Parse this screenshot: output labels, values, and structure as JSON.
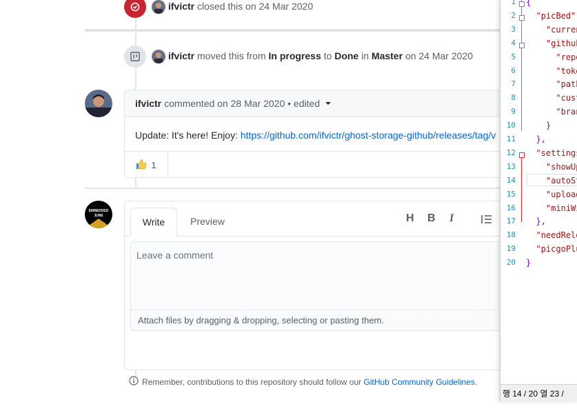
{
  "timeline": {
    "closed_event": {
      "user": "ifvictr",
      "action": "closed this on 24 Mar 2020"
    },
    "moved_event": {
      "user": "ifvictr",
      "text_moved": "moved this from",
      "from": "In progress",
      "to_word": "to",
      "to": "Done",
      "in_word": "in",
      "project": "Master",
      "date": "on 24 Mar 2020"
    }
  },
  "comment": {
    "author": "ifvictr",
    "meta": "commented on 28 Mar 2020 • edited",
    "body_text": "Update: It's here! Enjoy: ",
    "body_link": "https://github.com/ifvictr/ghost-storage-github/releases/tag/v",
    "reaction_count": "1"
  },
  "composer": {
    "tab_write": "Write",
    "tab_preview": "Preview",
    "tools": [
      "H",
      "B",
      "I"
    ],
    "placeholder": "Leave a comment",
    "attach_text": "Attach files by dragging & dropping, selecting or pasting them.",
    "avatar_text_1": "EMBEDDED",
    "avatar_text_2": "JUNE"
  },
  "guidelines": {
    "prefix": "Remember, contributions to this repository should follow our ",
    "link": "GitHub Community Guidelines",
    "suffix": "."
  },
  "editor": {
    "line_numbers": [
      "1",
      "2",
      "3",
      "4",
      "5",
      "6",
      "7",
      "8",
      "9",
      "10",
      "11",
      "12",
      "13",
      "14",
      "15",
      "16",
      "17",
      "18",
      "19",
      "20"
    ],
    "lines": [
      "{",
      "  \"picBed\":",
      "    \"curren",
      "    \"github",
      "      \"repo",
      "      \"toke",
      "      \"path",
      "      \"cust",
      "      \"bran",
      "    }",
      "  },",
      "  \"settings",
      "    \"showUp",
      "    \"autoSt",
      "    \"upload",
      "    \"miniWi",
      "  },",
      "  \"needRelo",
      "  \"picgoPlu",
      "}"
    ],
    "status": "행 14 / 20   열 23 /"
  },
  "colors": {
    "closed_red": "#cb2431",
    "link_blue": "#0366d6",
    "editor_key": "#a31515",
    "editor_brace": "#8000ff",
    "line_number": "#2b91af"
  }
}
